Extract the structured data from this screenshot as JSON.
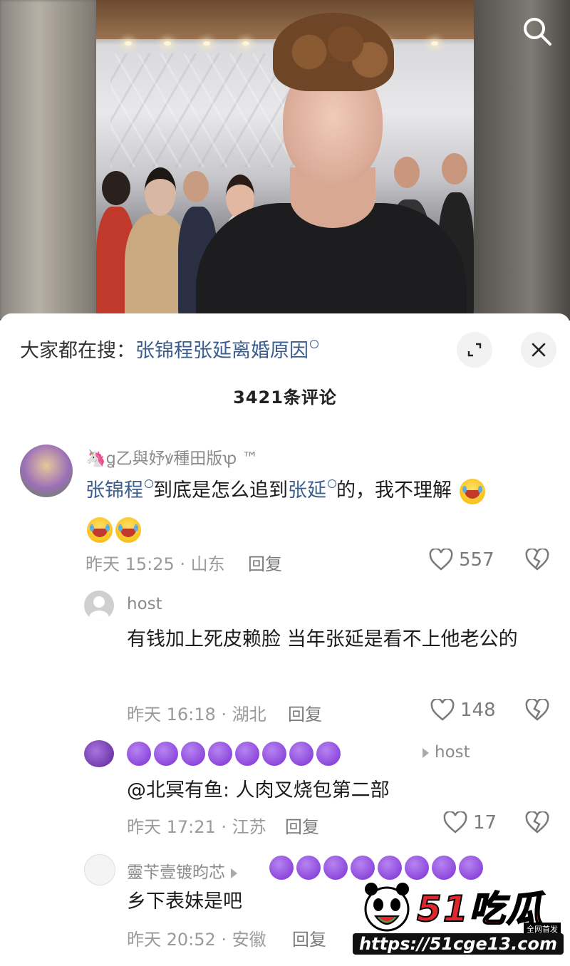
{
  "video": {
    "search_icon": "search-icon"
  },
  "sheet": {
    "trend_prefix": "大家都在搜：",
    "trend_query": "张锦程张延离婚原因",
    "comment_count": "3421条评论",
    "expand_icon": "expand-icon",
    "close_icon": "close-icon"
  },
  "comments": [
    {
      "user": "🦄ꬶ乙與妤ꝟ種田版ꝕ ™",
      "text_parts": [
        "张锦程",
        "到底是怎么追到",
        "张延",
        "的，我不理解"
      ],
      "time": "昨天 15:25 · 山东",
      "reply": "回复",
      "likes": "557"
    },
    {
      "user": "host",
      "text": "有钱加上死皮赖脸 当年张延是看不上他老公的",
      "time": "昨天 16:18 · 湖北",
      "reply": "回复",
      "likes": "148"
    },
    {
      "reply_to": "host",
      "text": "@北冥有鱼: 人肉叉烧包第二部",
      "time": "昨天 17:21 · 江苏",
      "reply": "回复",
      "likes": "17"
    },
    {
      "user": "靈苄壹镀昀芯",
      "text": "乡下表妹是吧",
      "time": "昨天 20:52 · 安徽",
      "reply": "回复"
    }
  ],
  "watermark": {
    "title": "51吃瓜",
    "badge": "全网首发",
    "url": "https://51cge13.com"
  },
  "colors": {
    "link": "#3b5e8f",
    "purple_dot": "#7b2fd4",
    "watermark_red": "#e0272d"
  }
}
